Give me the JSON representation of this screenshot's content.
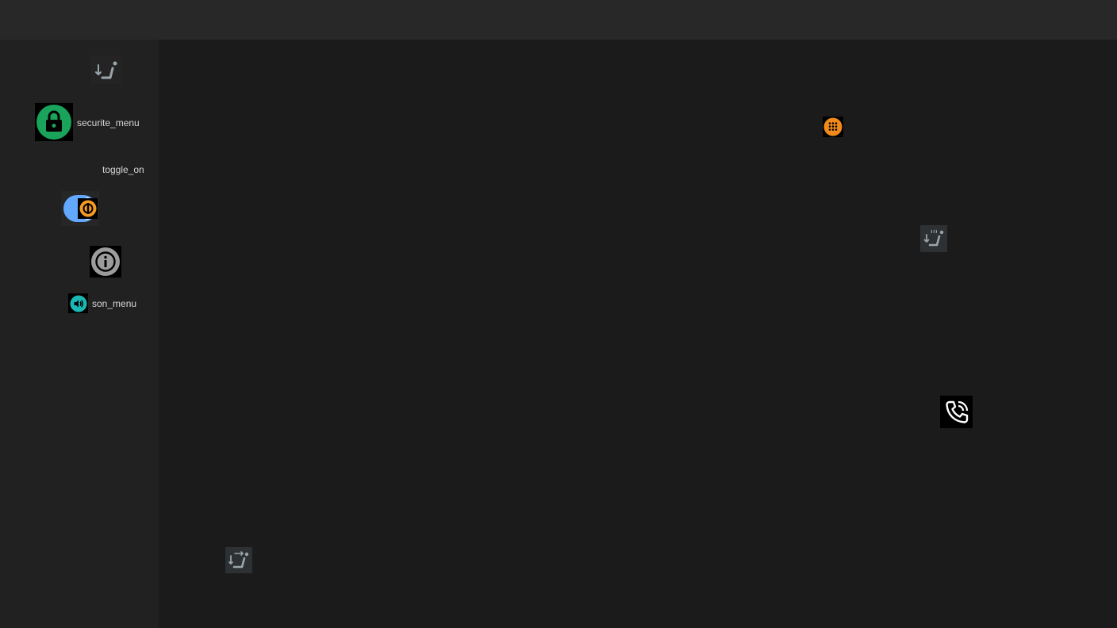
{
  "sidebar": {
    "items": [
      {
        "icon": "seat-recline-down-icon",
        "label": ""
      },
      {
        "icon": "lock-icon",
        "label": "securite_menu"
      },
      {
        "icon": "toggle-on-icon",
        "label": "toggle_on"
      },
      {
        "icon": "power-badge-icon",
        "label": ""
      },
      {
        "icon": "info-icon",
        "label": ""
      },
      {
        "icon": "volume-icon",
        "label": "son_menu"
      }
    ]
  },
  "main": {
    "icons": [
      {
        "icon": "dialpad-icon"
      },
      {
        "icon": "seat-heat-icon"
      },
      {
        "icon": "phone-call-icon"
      },
      {
        "icon": "seat-adjust-icon"
      }
    ]
  },
  "colors": {
    "topbar": "#282828",
    "sidebar": "#212121",
    "main": "#1b1b1b",
    "lock_green": "#1aa35a",
    "toggle_blue": "#63a8ff",
    "orange": "#f59a23",
    "teal": "#1ab7b5"
  }
}
